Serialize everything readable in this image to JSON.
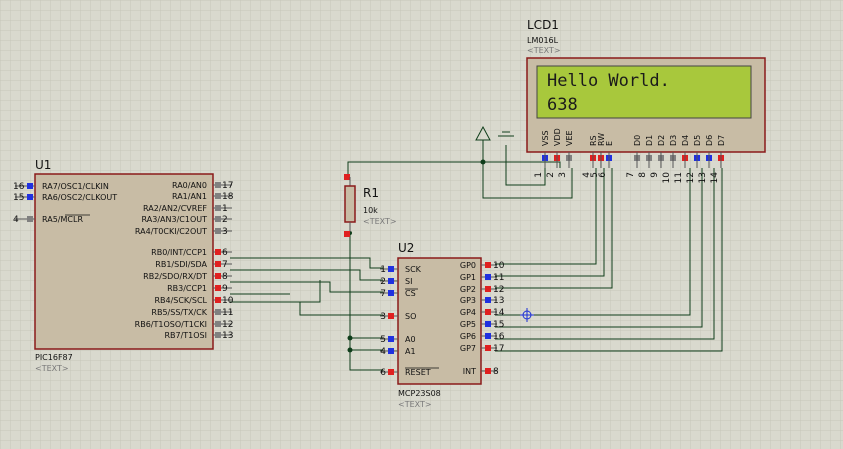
{
  "lcd": {
    "ref": "LCD1",
    "part": "LM016L",
    "text_tag": "<TEXT>",
    "line1": "Hello World.",
    "line2": "638",
    "pins": [
      {
        "name": "VSS",
        "num": "1"
      },
      {
        "name": "VDD",
        "num": "2"
      },
      {
        "name": "VEE",
        "num": "3"
      },
      {
        "name": "RS",
        "num": "4"
      },
      {
        "name": "RW",
        "num": "5"
      },
      {
        "name": "E",
        "num": "6"
      },
      {
        "name": "D0",
        "num": "7"
      },
      {
        "name": "D1",
        "num": "8"
      },
      {
        "name": "D2",
        "num": "9"
      },
      {
        "name": "D3",
        "num": "10"
      },
      {
        "name": "D4",
        "num": "11"
      },
      {
        "name": "D5",
        "num": "12"
      },
      {
        "name": "D6",
        "num": "13"
      },
      {
        "name": "D7",
        "num": "14"
      }
    ]
  },
  "u1": {
    "ref": "U1",
    "part": "PIC16F87",
    "text_tag": "<TEXT>",
    "left_pins": [
      {
        "name": "RA7/OSC1/CLKIN",
        "num": "16"
      },
      {
        "name": "RA6/OSC2/CLKOUT",
        "num": "15"
      },
      {
        "name": "RA5/MCLR",
        "num": "4"
      }
    ],
    "right_pins": [
      {
        "name": "RA0/AN0",
        "num": "17"
      },
      {
        "name": "RA1/AN1",
        "num": "18"
      },
      {
        "name": "RA2/AN2/CVREF",
        "num": "1"
      },
      {
        "name": "RA3/AN3/C1OUT",
        "num": "2"
      },
      {
        "name": "RA4/T0CKI/C2OUT",
        "num": "3"
      },
      {
        "name": "RB0/INT/CCP1",
        "num": "6"
      },
      {
        "name": "RB1/SDI/SDA",
        "num": "7"
      },
      {
        "name": "RB2/SDO/RX/DT",
        "num": "8"
      },
      {
        "name": "RB3/CCP1",
        "num": "9"
      },
      {
        "name": "RB4/SCK/SCL",
        "num": "10"
      },
      {
        "name": "RB5/SS/TX/CK",
        "num": "11"
      },
      {
        "name": "RB6/T1OSO/T1CKI",
        "num": "12"
      },
      {
        "name": "RB7/T1OSI",
        "num": "13"
      }
    ]
  },
  "r1": {
    "ref": "R1",
    "value": "10k",
    "text_tag": "<TEXT>"
  },
  "u2": {
    "ref": "U2",
    "part": "MCP23S08",
    "text_tag": "<TEXT>",
    "left_pins": [
      {
        "name": "SCK",
        "num": "1"
      },
      {
        "name": "SI",
        "num": "2"
      },
      {
        "name": "CS",
        "num": "7"
      },
      {
        "name": "SO",
        "num": "3"
      },
      {
        "name": "A0",
        "num": "5"
      },
      {
        "name": "A1",
        "num": "4"
      },
      {
        "name": "RESET",
        "num": "6"
      }
    ],
    "right_pins": [
      {
        "name": "GP0",
        "num": "10"
      },
      {
        "name": "GP1",
        "num": "11"
      },
      {
        "name": "GP2",
        "num": "12"
      },
      {
        "name": "GP3",
        "num": "13"
      },
      {
        "name": "GP4",
        "num": "14"
      },
      {
        "name": "GP5",
        "num": "15"
      },
      {
        "name": "GP6",
        "num": "16"
      },
      {
        "name": "GP7",
        "num": "17"
      },
      {
        "name": "INT",
        "num": "8"
      }
    ]
  },
  "colors": {
    "background": "#d9d9ce",
    "grid": "#c6c6ba",
    "chip_fill": "#c8bca5",
    "chip_border": "#8b1a1a",
    "lcd_screen": "#a8c83c",
    "wire": "#0f3d1a",
    "pin_high": "#e02020",
    "pin_low": "#2030e0",
    "pin_float": "#808080"
  }
}
